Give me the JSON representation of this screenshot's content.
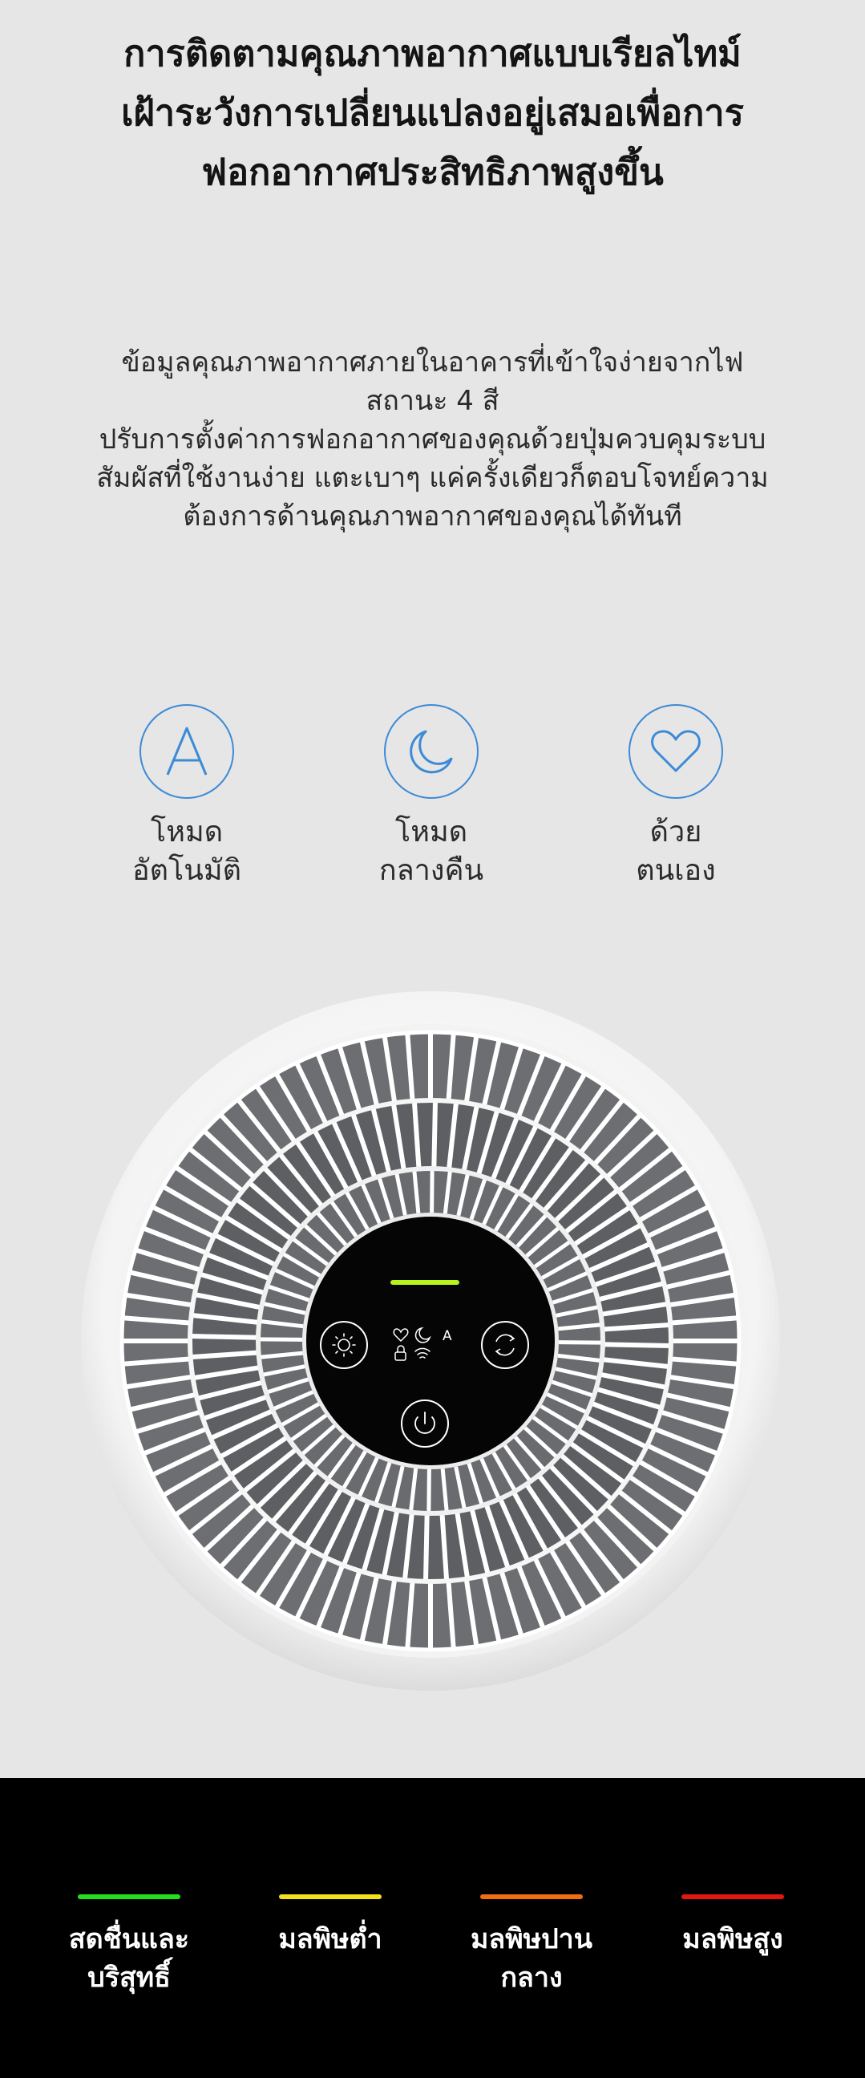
{
  "heading": {
    "title": "การติดตามคุณภาพอากาศแบบเรียลไทม์\nเฝ้าระวังการเปลี่ยนแปลงอยู่เสมอเพื่อการ\nฟอกอากาศประสิทธิภาพสูงขึ้น"
  },
  "description": {
    "text": "ข้อมูลคุณภาพอากาศภายในอาคารที่เข้าใจง่ายจากไฟ\nสถานะ 4 สี\nปรับการตั้งค่าการฟอกอากาศของคุณด้วยปุ่มควบคุมระบบ\nสัมผัสที่ใช้งานง่าย แตะเบาๆ แค่ครั้งเดียวก็ตอบโจทย์ความ\nต้องการด้านคุณภาพอากาศของคุณได้ทันที"
  },
  "modes": [
    {
      "icon": "letter-a-icon",
      "label": "โหมด\nอัตโนมัติ"
    },
    {
      "icon": "moon-icon",
      "label": "โหมด\nกลางคืน"
    },
    {
      "icon": "heart-icon",
      "label": "ด้วย\nตนเอง"
    }
  ],
  "device_panel": {
    "status_light_color": "#b7f21a",
    "icons": [
      "sun-icon",
      "heart-icon",
      "moon-icon",
      "letter-a-icon",
      "lock-icon",
      "wifi-icon",
      "cycle-icon",
      "power-icon"
    ],
    "indicator_letter": "A"
  },
  "levels": [
    {
      "label": "สดชื่นและ\nบริสุทธิ์",
      "color": "#22e01b"
    },
    {
      "label": "มลพิษต่ำ",
      "color": "#f2e21b"
    },
    {
      "label": "มลพิษปาน\nกลาง",
      "color": "#f26d12"
    },
    {
      "label": "มลพิษสูง",
      "color": "#e2170e"
    }
  ],
  "colors": {
    "background": "#e6e6e6",
    "accent_blue": "#3d8ad6",
    "bottom_band": "#000000"
  }
}
